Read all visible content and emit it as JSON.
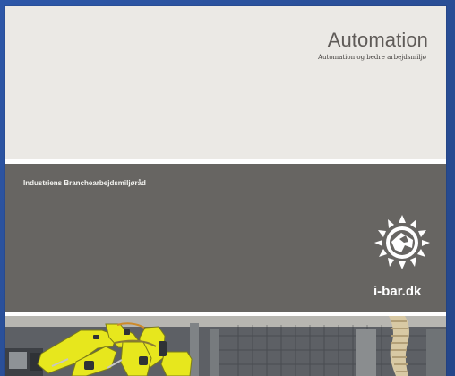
{
  "document": {
    "title": "Automation",
    "subtitle": "Automation og bedre arbejdsmiljø",
    "organization": "Industriens Branchearbejdsmiljøråd",
    "website": "i-bar.dk",
    "logo_icon": "sun-emblem-icon",
    "photo": "industrial-automation-photo"
  },
  "colors": {
    "background_blue": "#2b53a0",
    "cover_light": "#ebe9e5",
    "cover_dark": "#676562",
    "machine_yellow": "#e7e71d",
    "text_light": "#ffffff"
  }
}
